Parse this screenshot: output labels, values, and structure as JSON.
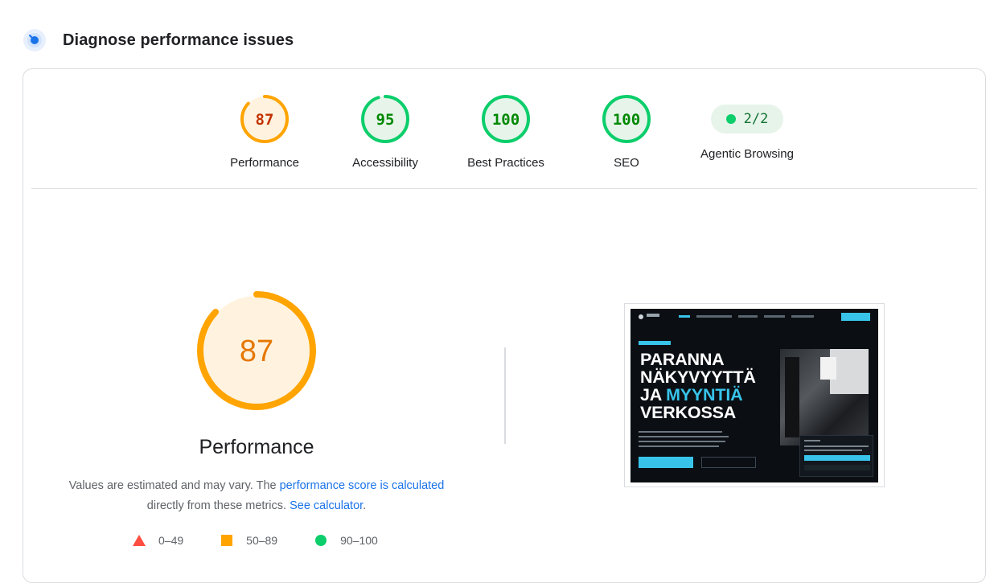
{
  "header": {
    "title": "Diagnose performance issues",
    "icon": "lighthouse-gauge-icon"
  },
  "scores": [
    {
      "name": "performance",
      "value": "87",
      "label": "Performance",
      "fraction": 0.87,
      "color": "#ffa400",
      "text_color": "#c33300",
      "bg": "#fff3e0"
    },
    {
      "name": "accessibility",
      "value": "95",
      "label": "Accessibility",
      "fraction": 0.95,
      "color": "#0cce6b",
      "text_color": "#008800",
      "bg": "#e6f4ea"
    },
    {
      "name": "best-practices",
      "value": "100",
      "label": "Best Practices",
      "fraction": 1.0,
      "color": "#0cce6b",
      "text_color": "#008800",
      "bg": "#e6f4ea"
    },
    {
      "name": "seo",
      "value": "100",
      "label": "SEO",
      "fraction": 1.0,
      "color": "#0cce6b",
      "text_color": "#008800",
      "bg": "#e6f4ea"
    }
  ],
  "agentic": {
    "value": "2/2",
    "label": "Agentic Browsing",
    "dot_color": "#0cce6b"
  },
  "performance_detail": {
    "score": "87",
    "fraction": 0.87,
    "title": "Performance",
    "desc_part1": "Values are estimated and may vary. The ",
    "desc_link1": "performance score is calculated",
    "desc_part2": "directly from these metrics.",
    "desc_link2": "See calculator",
    "desc_end": "."
  },
  "legend": [
    {
      "range": "0–49",
      "shape": "triangle",
      "color": "#ff4e42"
    },
    {
      "range": "50–89",
      "shape": "square",
      "color": "#ffa400"
    },
    {
      "range": "90–100",
      "shape": "circle",
      "color": "#0cce6b"
    }
  ],
  "screenshot": {
    "hero_line1": "PARANNA",
    "hero_line2": "NÄKYVYYTTÄ",
    "hero_line3a": "JA ",
    "hero_line3b": "MYYNTIÄ",
    "hero_line4": "VERKOSSA",
    "accent_color": "#38c4ea"
  }
}
